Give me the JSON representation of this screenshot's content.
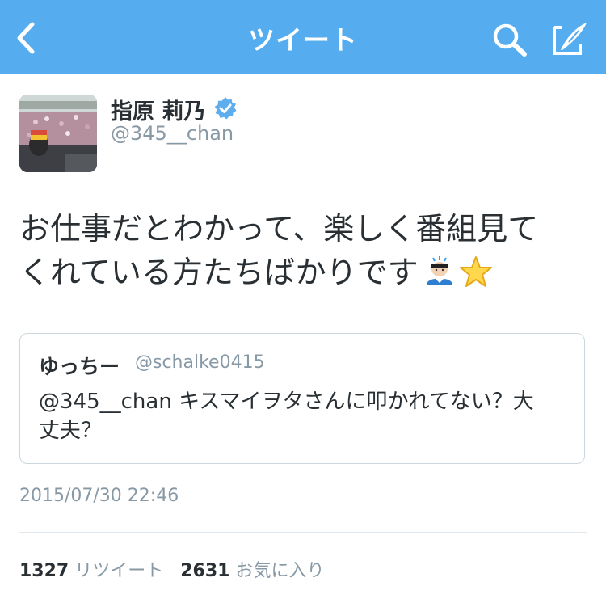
{
  "navbar": {
    "title": "ツイート",
    "back_icon": "chevron-left-icon",
    "search_icon": "search-icon",
    "compose_icon": "compose-icon",
    "background": "#55acee"
  },
  "tweet": {
    "author_name": "指原 莉乃",
    "author_handle": "@345__chan",
    "verified_icon": "verified-badge-icon",
    "text_line1": "お仕事だとわかって、楽しく番組見て",
    "text_line2": "くれている方たちばかりです",
    "emojis": [
      "person-bowing-emoji",
      "star-emoji"
    ],
    "timestamp": "2015/07/30 22:46"
  },
  "quoted_tweet": {
    "author_name": "ゆっちー",
    "author_handle": "@schalke0415",
    "text_line1": "@345__chan キスマイヲタさんに叩かれてない？大",
    "text_line2": "丈夫？"
  },
  "stats": {
    "retweets_count": "1327",
    "retweets_label": "リツイート",
    "favorites_count": "2631",
    "favorites_label": "お気に入り"
  },
  "colors": {
    "accent": "#55acee",
    "text": "#292f33",
    "muted": "#8899a6",
    "border": "#ccd6dd"
  }
}
